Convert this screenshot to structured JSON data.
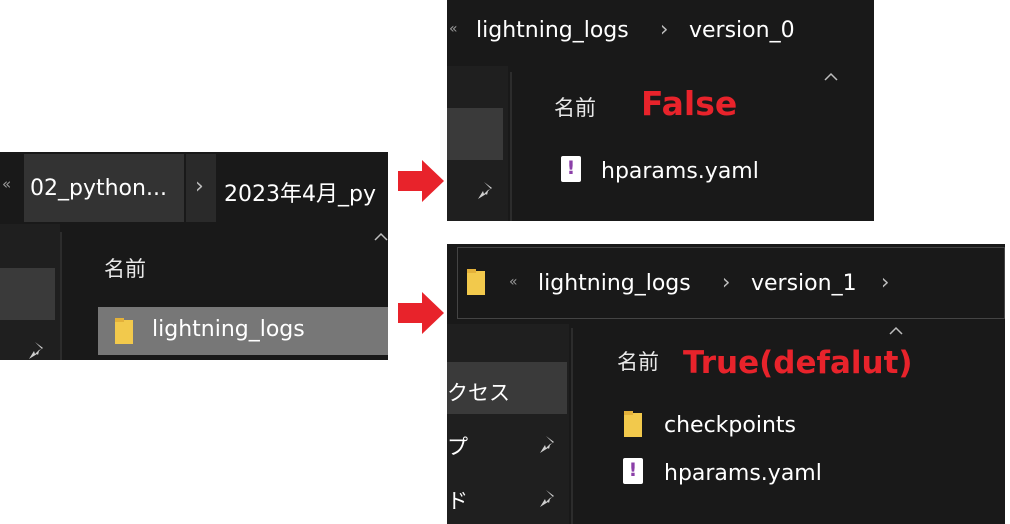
{
  "left_panel": {
    "breadcrumb": [
      "02_python...",
      "2023年4月_py"
    ],
    "column_header": "名前",
    "items": [
      {
        "label": "lightning_logs",
        "type": "folder"
      }
    ]
  },
  "false_panel": {
    "breadcrumb": [
      "lightning_logs",
      "version_0"
    ],
    "column_header": "名前",
    "annotation": "False",
    "items": [
      {
        "label": "hparams.yaml",
        "type": "yaml"
      }
    ]
  },
  "true_panel": {
    "breadcrumb": [
      "lightning_logs",
      "version_1"
    ],
    "column_header": "名前",
    "annotation": "True(defalut)",
    "nav_labels": [
      "クセス",
      "プ",
      "ド"
    ],
    "items": [
      {
        "label": "checkpoints",
        "type": "folder"
      },
      {
        "label": "hparams.yaml",
        "type": "yaml"
      }
    ]
  },
  "colors": {
    "panel_bg": "#191919",
    "accent_red": "#e8232b",
    "folder_yellow": "#f2c94c",
    "yaml_purple": "#8b3fa8"
  },
  "icons": {
    "back_chevrons": "«",
    "separator": "›",
    "file_icon_glyph": "!"
  }
}
